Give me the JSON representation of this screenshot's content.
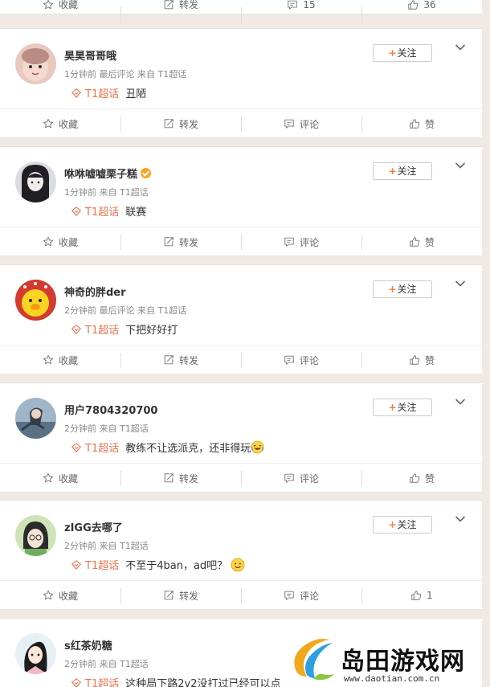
{
  "top_actions": {
    "collect": "收藏",
    "repost": "转发",
    "comments": "15",
    "likes": "36"
  },
  "posts": [
    {
      "username": "昊昊哥哥哦",
      "verified": false,
      "meta": "1分钟前 最后评论 来自 T1超话",
      "topic": "T1超话",
      "text": "丑陋",
      "follow_label": "关注",
      "actions": {
        "collect": "收藏",
        "repost": "转发",
        "comment": "评论",
        "like": "赞"
      }
    },
    {
      "username": "咻咻嘘嘘栗子糕",
      "verified": true,
      "meta": "1分钟前 来自 T1超话",
      "topic": "T1超话",
      "text": "联赛",
      "follow_label": "关注",
      "actions": {
        "collect": "收藏",
        "repost": "转发",
        "comment": "评论",
        "like": "赞"
      }
    },
    {
      "username": "神奇的胖der",
      "verified": false,
      "meta": "2分钟前 最后评论 来自 T1超话",
      "topic": "T1超话",
      "text": "下把好好打",
      "follow_label": "关注",
      "actions": {
        "collect": "收藏",
        "repost": "转发",
        "comment": "评论",
        "like": "赞"
      }
    },
    {
      "username": "用户7804320700",
      "verified": false,
      "meta": "2分钟前 来自 T1超话",
      "topic": "T1超话",
      "text": "教练不让选派克，还非得玩",
      "emoji": "laugh-cry",
      "follow_label": "关注",
      "actions": {
        "collect": "收藏",
        "repost": "转发",
        "comment": "评论",
        "like": "赞"
      }
    },
    {
      "username": "zIGG去哪了",
      "verified": false,
      "meta": "2分钟前 来自 T1超话",
      "topic": "T1超话",
      "text": "不至于4ban，ad吧？",
      "emoji": "smile",
      "follow_label": "关注",
      "actions": {
        "collect": "收藏",
        "repost": "转发",
        "comment": "评论",
        "like": "1"
      }
    },
    {
      "username": "s红茶奶糖",
      "verified": false,
      "meta": "2分钟前 来自 T1超话",
      "topic": "T1超话",
      "text": "这种局下路2v2没打过已经可以点"
    }
  ],
  "watermark": {
    "text": "岛田游戏网",
    "url": "www.daotian.com.cn"
  },
  "colors": {
    "accent": "#eb7350",
    "follow_plus": "#fa7d3c",
    "page_bg": "#f1e9e3"
  }
}
